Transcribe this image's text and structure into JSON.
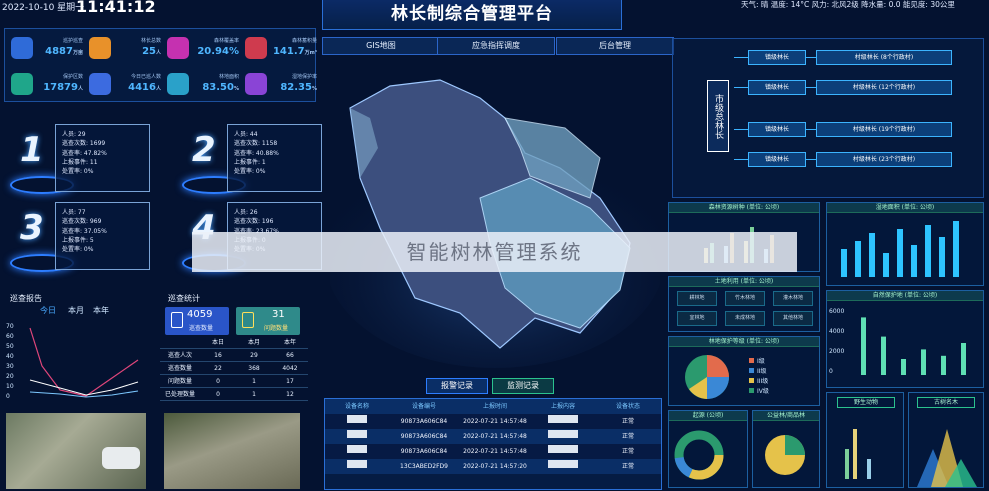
{
  "top": {
    "datetime": "2022-10-10 星期一",
    "clock": "11:41:12",
    "weather": "天气: 晴  温度: 14°C  风力: 北风2级  降水量: 0.0  能见度: 30公里",
    "title": "林长制综合管理平台"
  },
  "nav": [
    "GIS地图",
    "应急指挥调度",
    "后台管理"
  ],
  "stats": [
    {
      "label": "巡护巡查",
      "value": "4887",
      "unit": "万亩",
      "color": "#2f6bd8"
    },
    {
      "label": "林长总数",
      "value": "25",
      "unit": "人",
      "color": "#e8912a"
    },
    {
      "label": "森林覆盖率",
      "value": "20.94%",
      "unit": "",
      "color": "#c531b0"
    },
    {
      "label": "森林蓄积量",
      "value": "141.7",
      "unit": "万m³",
      "color": "#cf3b4e"
    },
    {
      "label": "保护区数",
      "value": "17879",
      "unit": "人",
      "color": "#1fa68a"
    },
    {
      "label": "今日已巡人数",
      "value": "4416",
      "unit": "人",
      "color": "#3c6be0"
    },
    {
      "label": "林地面积",
      "value": "83.50",
      "unit": "%",
      "color": "#2aa1c9"
    },
    {
      "label": "湿地保护率",
      "value": "82.35",
      "unit": "%",
      "color": "#8a44d6"
    }
  ],
  "persons": [
    {
      "rank": "1",
      "people": "人员: 29",
      "count": "巡查次数: 1699",
      "rate": "巡查率: 47.82%",
      "events": "上报事件: 11",
      "handle": "处置率: 0%"
    },
    {
      "rank": "2",
      "people": "人员: 44",
      "count": "巡查次数: 1158",
      "rate": "巡查率: 40.88%",
      "events": "上报事件: 1",
      "handle": "处置率: 0%"
    },
    {
      "rank": "3",
      "people": "人员: 77",
      "count": "巡查次数: 969",
      "rate": "巡查率: 37.05%",
      "events": "上报事件: 5",
      "handle": "处置率: 0%"
    },
    {
      "rank": "4",
      "people": "人员: 26",
      "count": "巡查次数: 196",
      "rate": "巡查率: 23.67%",
      "events": "上报事件: 0",
      "handle": "处置率: 0%"
    }
  ],
  "patrol_report": {
    "title": "巡查报告",
    "tabs": [
      "今日",
      "本月",
      "本年"
    ],
    "y_ticks": [
      "70",
      "60",
      "50",
      "40",
      "30",
      "20",
      "10",
      "0"
    ]
  },
  "patrol_stats": {
    "title": "巡查统计",
    "cards": [
      {
        "value": "4059",
        "label": "巡查数量"
      },
      {
        "value": "31",
        "label": "问题数量"
      }
    ],
    "columns": [
      "",
      "本日",
      "本月",
      "本年"
    ],
    "rows": [
      [
        "巡查人次",
        "16",
        "29",
        "66"
      ],
      [
        "巡查数量",
        "22",
        "368",
        "4042"
      ],
      [
        "问题数量",
        "0",
        "1",
        "17"
      ],
      [
        "已处理数量",
        "0",
        "1",
        "12"
      ]
    ]
  },
  "hierarchy": {
    "root": "市级总林长",
    "levels": [
      "镇级林长",
      "镇级林长",
      "镇级林长",
      "镇级林长"
    ],
    "villages": [
      "村级林长 (8个行政村)",
      "村级林长 (12个行政村)",
      "村级林长 (19个行政村)",
      "村级林长 (23个行政村)"
    ]
  },
  "right_panels": {
    "forest_resource": "森林资源树种 (单位: 公顷)",
    "wetland": "湿地面积 (单位: 公顷)",
    "land_use": "土地利用 (单位: 公顷)",
    "land_tiles": [
      "耕林地",
      "竹木林地",
      "灌木林地",
      "宜林地",
      "未成林地",
      "其他林地"
    ],
    "protect_level": "林地保护等级 (单位: 公顷)",
    "nature_reserve": "自然保护地 (单位: 公顷)",
    "reserve_ticks": [
      "6000",
      "4000",
      "2000",
      "0"
    ],
    "legend": [
      "I级",
      "II级",
      "III级",
      "IV级"
    ],
    "fauna": "野生动物",
    "flora": "古树名木",
    "forest_area": "起源 (公顷)",
    "public_forest": "公益林/商品林"
  },
  "records": {
    "tabs": [
      "报警记录",
      "监测记录"
    ],
    "headers": [
      "设备名称",
      "设备编号",
      "上报时间",
      "上报内容",
      "设备状态"
    ],
    "rows": [
      [
        "90873A606C84",
        "2022-07-21 14:57:48",
        "正常"
      ],
      [
        "90873A606C84",
        "2022-07-21 14:57:48",
        "正常"
      ],
      [
        "90873A606C84",
        "2022-07-21 14:57:48",
        "正常"
      ],
      [
        "13C3ABED2FD9",
        "2022-07-21 14:57:20",
        "正常"
      ]
    ]
  },
  "watermark": "智能树林管理系统",
  "colors": {
    "accent": "#2d7dff",
    "bg": "#041230"
  }
}
